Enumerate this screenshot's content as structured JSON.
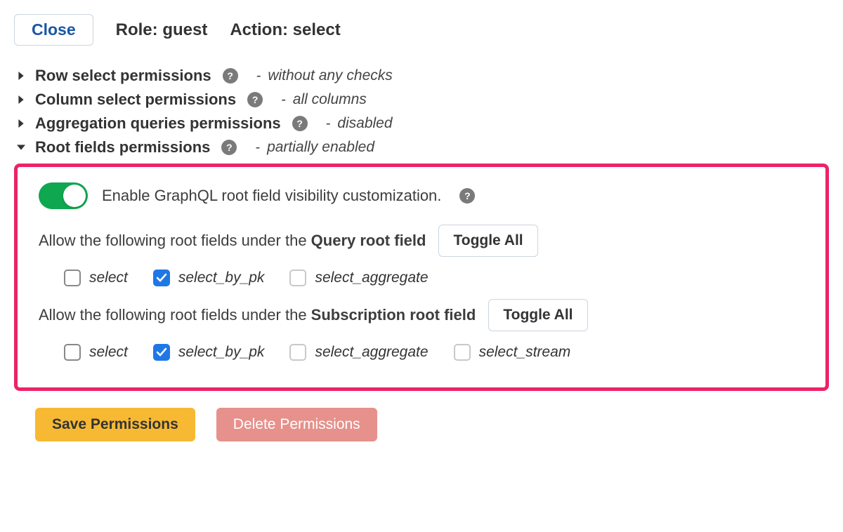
{
  "header": {
    "close": "Close",
    "role_prefix": "Role:",
    "role_value": "guest",
    "action_prefix": "Action:",
    "action_value": "select"
  },
  "sections": {
    "row": {
      "title": "Row select permissions",
      "status": "without any checks"
    },
    "column": {
      "title": "Column select permissions",
      "status": "all columns"
    },
    "aggregation": {
      "title": "Aggregation queries permissions",
      "status": "disabled"
    },
    "root_fields": {
      "title": "Root fields permissions",
      "status": "partially enabled"
    }
  },
  "root_fields_panel": {
    "enable_label": "Enable GraphQL root field visibility customization.",
    "query_text_prefix": "Allow the following root fields under the ",
    "query_text_bold": "Query root field",
    "subscription_text_prefix": "Allow the following root fields under the ",
    "subscription_text_bold": "Subscription root field",
    "toggle_all": "Toggle All",
    "query_options": {
      "select": "select",
      "select_by_pk": "select_by_pk",
      "select_aggregate": "select_aggregate"
    },
    "subscription_options": {
      "select": "select",
      "select_by_pk": "select_by_pk",
      "select_aggregate": "select_aggregate",
      "select_stream": "select_stream"
    }
  },
  "footer": {
    "save": "Save Permissions",
    "delete": "Delete Permissions"
  },
  "dash": "-"
}
